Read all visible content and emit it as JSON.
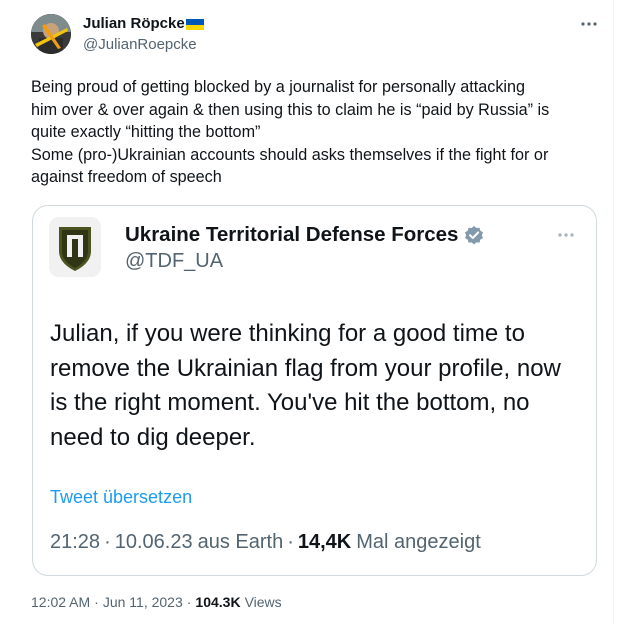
{
  "author": {
    "name": "Julian Röpcke",
    "handle": "@JulianRoepcke",
    "flag_colors": [
      "#0057b7",
      "#ffd700"
    ]
  },
  "tweet": {
    "text": "Being proud of getting blocked by a journalist for personally attacking\nhim over & over again & then using this to claim he is “paid by Russia” is\nquite exactly “hitting the bottom”\nSome (pro-)Ukrainian accounts should asks themselves if the fight for or\nagainst freedom of speech",
    "time": "12:02 AM",
    "date": "Jun 11, 2023",
    "views_count": "104.3K",
    "views_label": "Views"
  },
  "quote": {
    "name": "Ukraine Territorial Defense Forces",
    "handle": "@TDF_UA",
    "text": "Julian, if you were thinking for a good time to\nremove the Ukrainian flag from your profile, now\nis the right moment. You've hit the bottom, no\nneed to dig deeper.",
    "translate": "Tweet übersetzen",
    "time": "21:28",
    "date": "10.06.23",
    "source": "aus Earth",
    "views_count": "14,4K",
    "views_label": "Mal angezeigt"
  },
  "icons": {
    "more": "more-horizontal-icon",
    "verified": "verified-badge-icon"
  },
  "colors": {
    "link": "#1d9bf0",
    "secondary_text": "#536471",
    "border": "#cfd9de",
    "verified_badge": "#829aab"
  }
}
